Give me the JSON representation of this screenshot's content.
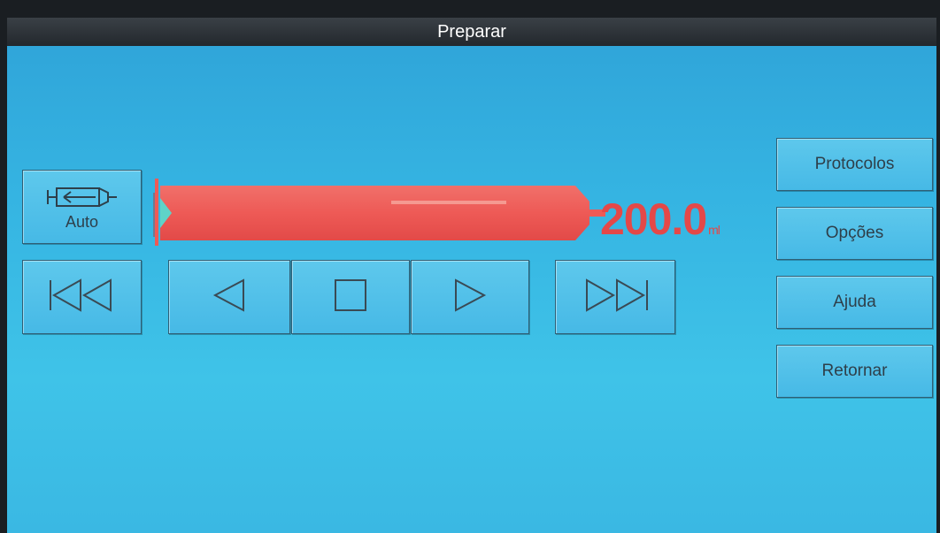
{
  "window": {
    "title": "Preparar"
  },
  "pump": {
    "auto_label": "Auto",
    "volume_value": "200.0",
    "volume_unit": "ml",
    "fill_fraction": 1.0
  },
  "controls": {
    "skip_back": "skip-to-start-icon",
    "step_back": "step-back-icon",
    "stop": "stop-icon",
    "step_forward": "step-forward-icon",
    "skip_forward": "skip-to-end-icon"
  },
  "side_menu": {
    "protocols": "Protocolos",
    "options": "Opções",
    "help": "Ajuda",
    "return": "Retornar"
  },
  "colors": {
    "background": "#3ab8e3",
    "titlebar": "#2a2f34",
    "bar_fill": "#ee5a56",
    "volume_text": "#e44848"
  }
}
